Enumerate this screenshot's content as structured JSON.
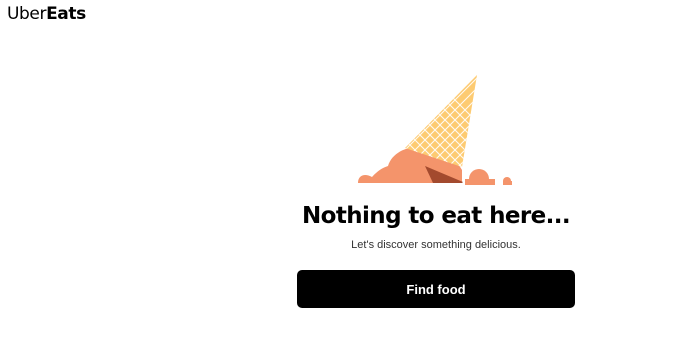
{
  "header": {
    "logo_uber": "Uber",
    "logo_eats": "Eats"
  },
  "empty_state": {
    "illustration_icon": "melted-ice-cream-cone-icon",
    "title": "Nothing to eat here...",
    "subtitle": "Let's discover something delicious.",
    "button_label": "Find food"
  },
  "colors": {
    "button_background": "#000000",
    "button_text": "#ffffff",
    "ice_cream": "#f4946b",
    "cone": "#fdcb72",
    "cone_grid": "#ffffff"
  }
}
